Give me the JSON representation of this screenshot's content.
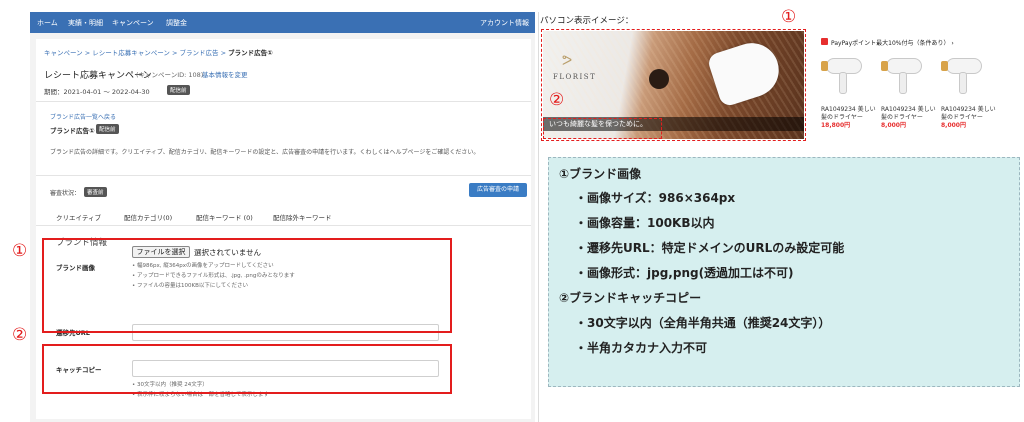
{
  "topnav": {
    "items": [
      "ホーム",
      "実績・明細",
      "キャンペーン",
      "調整金"
    ],
    "account": "アカウント情報"
  },
  "breadcrumb": {
    "path": "キャンペーン > レシート応募キャンペーン > ブランド広告 >",
    "current": "ブランド広告①"
  },
  "campaign": {
    "title": "レシート応募キャンペーン",
    "id": "(キャンペーンID: 108)",
    "edit_link": "基本情報を変更",
    "period": "期間：2021-04-01 ～ 2022-04-30",
    "period_badge": "配信前"
  },
  "ad": {
    "back_link": "ブランド広告一覧へ戻る",
    "title": "ブランド広告①",
    "status_badge": "配信前",
    "description": "ブランド広告の詳細です。クリエイティブ、配信カテゴリ、配信キーワードの設定と、広告審査の申請を行います。くわしくはヘルプページをご確認ください。",
    "review_label": "審査状況：",
    "review_badge": "審査前",
    "apply_button": "広告審査の申請",
    "tabs": [
      "クリエイティブ",
      "配信カテゴリ(0)",
      "配信キーワード (0)",
      "配信除外キーワード"
    ]
  },
  "brand_info": {
    "section_title": "ブランド情報",
    "image_label": "ブランド画像",
    "file_button": "ファイルを選択",
    "file_status": "選択されていません",
    "image_notes": [
      "幅986px, 縦364pxの画像をアップロードしてください",
      "アップロードできるファイル形式は、.jpg, .pngのみとなります",
      "ファイルの容量は100KB以下にしてください"
    ],
    "url_label": "遷移先URL",
    "url_value": "",
    "catch_label": "キャッチコピー",
    "catch_value": "",
    "catch_notes": [
      "30文字以内（推奨 24文字）",
      "表示枠に収まらない場合は一部を省略して表示します"
    ]
  },
  "annotations": {
    "num1": "①",
    "num2": "②",
    "color": "#e31d1d"
  },
  "preview": {
    "title": "パソコン表示イメージ：",
    "brand_logo": "FLORIST",
    "catch_copy": "いつも綺麗な髪を保つために。",
    "promo_title": "PayPayポイント最大10%付与（条件あり） ›",
    "products": [
      {
        "name": "RA1049234 美しい髪のドライヤー",
        "price": "18,800円"
      },
      {
        "name": "RA1049234 美しい髪のドライヤー",
        "price": "8,000円"
      },
      {
        "name": "RA1049234 美しい髪のドライヤー",
        "price": "8,000円"
      }
    ]
  },
  "spec": {
    "lines": [
      "①ブランド画像",
      "・画像サイズ：986×364px",
      "・画像容量：100KB以内",
      "・遷移先URL：特定ドメインのURLのみ設定可能",
      "・画像形式：jpg,png(透過加工は不可)",
      "②ブランドキャッチコピー",
      "・30文字以内（全角半角共通（推奨24文字））",
      "・半角カタカナ入力不可"
    ]
  }
}
